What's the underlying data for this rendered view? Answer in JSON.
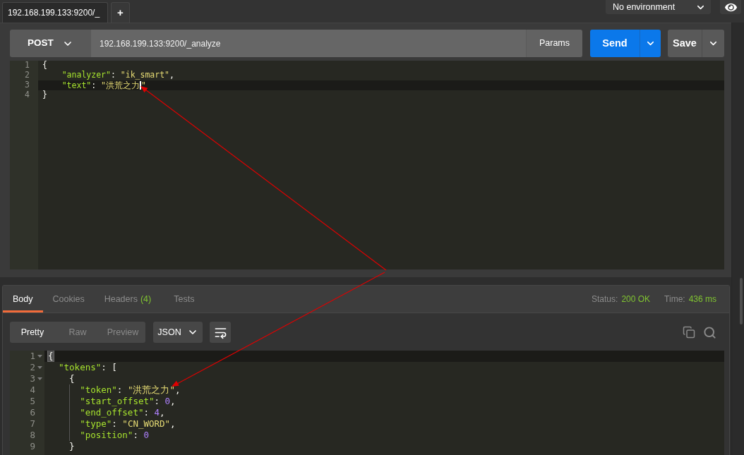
{
  "top_bar": {
    "tabs": [
      {
        "label": "192.168.199.133:9200/_",
        "selected": true
      }
    ],
    "new_tab_button": "+",
    "environment": "No environment"
  },
  "request": {
    "method": "POST",
    "url": "192.168.199.133:9200/_analyze",
    "params_button": "Params",
    "send_button": "Send",
    "save_button": "Save"
  },
  "request_body": {
    "lines": [
      {
        "number": "1",
        "highlighted": false,
        "segments": [
          {
            "kind": "punct",
            "text": "{"
          }
        ],
        "children": [
          {
            "number": "2",
            "highlighted": false,
            "segments": [
              {
                "kind": "key",
                "text": "\"analyzer\""
              },
              {
                "kind": "punct",
                "text": ": "
              },
              {
                "kind": "string",
                "text": "\"ik_smart\""
              },
              {
                "kind": "punct",
                "text": ","
              }
            ]
          },
          {
            "number": "3",
            "highlighted": true,
            "segments": [
              {
                "kind": "key",
                "text": "\"text\""
              },
              {
                "kind": "punct",
                "text": ": "
              },
              {
                "kind": "string",
                "text": "\"洪荒之力"
              },
              {
                "kind": "cursor"
              },
              {
                "kind": "string",
                "text": "\""
              }
            ]
          }
        ]
      },
      {
        "number": "4",
        "highlighted": false,
        "segments": [
          {
            "kind": "punct",
            "text": "}"
          }
        ]
      }
    ]
  },
  "response": {
    "tabs": [
      {
        "label": "Body",
        "selected": true
      },
      {
        "label": "Cookies",
        "selected": false
      },
      {
        "label": "Headers",
        "count": "(4)",
        "selected": false
      },
      {
        "label": "Tests",
        "selected": false
      }
    ],
    "status": {
      "label": "Status:",
      "value": "200 OK"
    },
    "time": {
      "label": "Time:",
      "value": "436 ms"
    },
    "view_modes": [
      {
        "label": "Pretty",
        "selected": true
      },
      {
        "label": "Raw",
        "selected": false
      },
      {
        "label": "Preview",
        "selected": false
      }
    ],
    "format": "JSON",
    "body": {
      "lines": [
        {
          "number": "1",
          "foldable": true,
          "highlighted": true,
          "segments": [
            {
              "kind": "match",
              "text": "{"
            }
          ],
          "children": [
            {
              "number": "2",
              "foldable": true,
              "highlighted": false,
              "segments": [
                {
                  "kind": "key",
                  "text": "\"tokens\""
                },
                {
                  "kind": "punct",
                  "text": ": ["
                }
              ],
              "children": [
                {
                  "number": "3",
                  "foldable": true,
                  "highlighted": false,
                  "segments": [
                    {
                      "kind": "punct",
                      "text": "{"
                    }
                  ],
                  "children": [
                    {
                      "number": "4",
                      "foldable": false,
                      "highlighted": false,
                      "segments": [
                        {
                          "kind": "key",
                          "text": "\"token\""
                        },
                        {
                          "kind": "punct",
                          "text": ": "
                        },
                        {
                          "kind": "string",
                          "text": "\"洪荒之力\""
                        },
                        {
                          "kind": "punct",
                          "text": ","
                        }
                      ]
                    },
                    {
                      "number": "5",
                      "foldable": false,
                      "highlighted": false,
                      "segments": [
                        {
                          "kind": "key",
                          "text": "\"start_offset\""
                        },
                        {
                          "kind": "punct",
                          "text": ": "
                        },
                        {
                          "kind": "number",
                          "text": "0"
                        },
                        {
                          "kind": "punct",
                          "text": ","
                        }
                      ]
                    },
                    {
                      "number": "6",
                      "foldable": false,
                      "highlighted": false,
                      "segments": [
                        {
                          "kind": "key",
                          "text": "\"end_offset\""
                        },
                        {
                          "kind": "punct",
                          "text": ": "
                        },
                        {
                          "kind": "number",
                          "text": "4"
                        },
                        {
                          "kind": "punct",
                          "text": ","
                        }
                      ]
                    },
                    {
                      "number": "7",
                      "foldable": false,
                      "highlighted": false,
                      "segments": [
                        {
                          "kind": "key",
                          "text": "\"type\""
                        },
                        {
                          "kind": "punct",
                          "text": ": "
                        },
                        {
                          "kind": "string",
                          "text": "\"CN_WORD\""
                        },
                        {
                          "kind": "punct",
                          "text": ","
                        }
                      ]
                    },
                    {
                      "number": "8",
                      "foldable": false,
                      "highlighted": false,
                      "segments": [
                        {
                          "kind": "key",
                          "text": "\"position\""
                        },
                        {
                          "kind": "punct",
                          "text": ": "
                        },
                        {
                          "kind": "number",
                          "text": "0"
                        }
                      ]
                    }
                  ]
                },
                {
                  "number": "9",
                  "foldable": false,
                  "highlighted": false,
                  "segments": [
                    {
                      "kind": "punct",
                      "text": "}"
                    }
                  ]
                }
              ]
            }
          ]
        }
      ]
    }
  }
}
